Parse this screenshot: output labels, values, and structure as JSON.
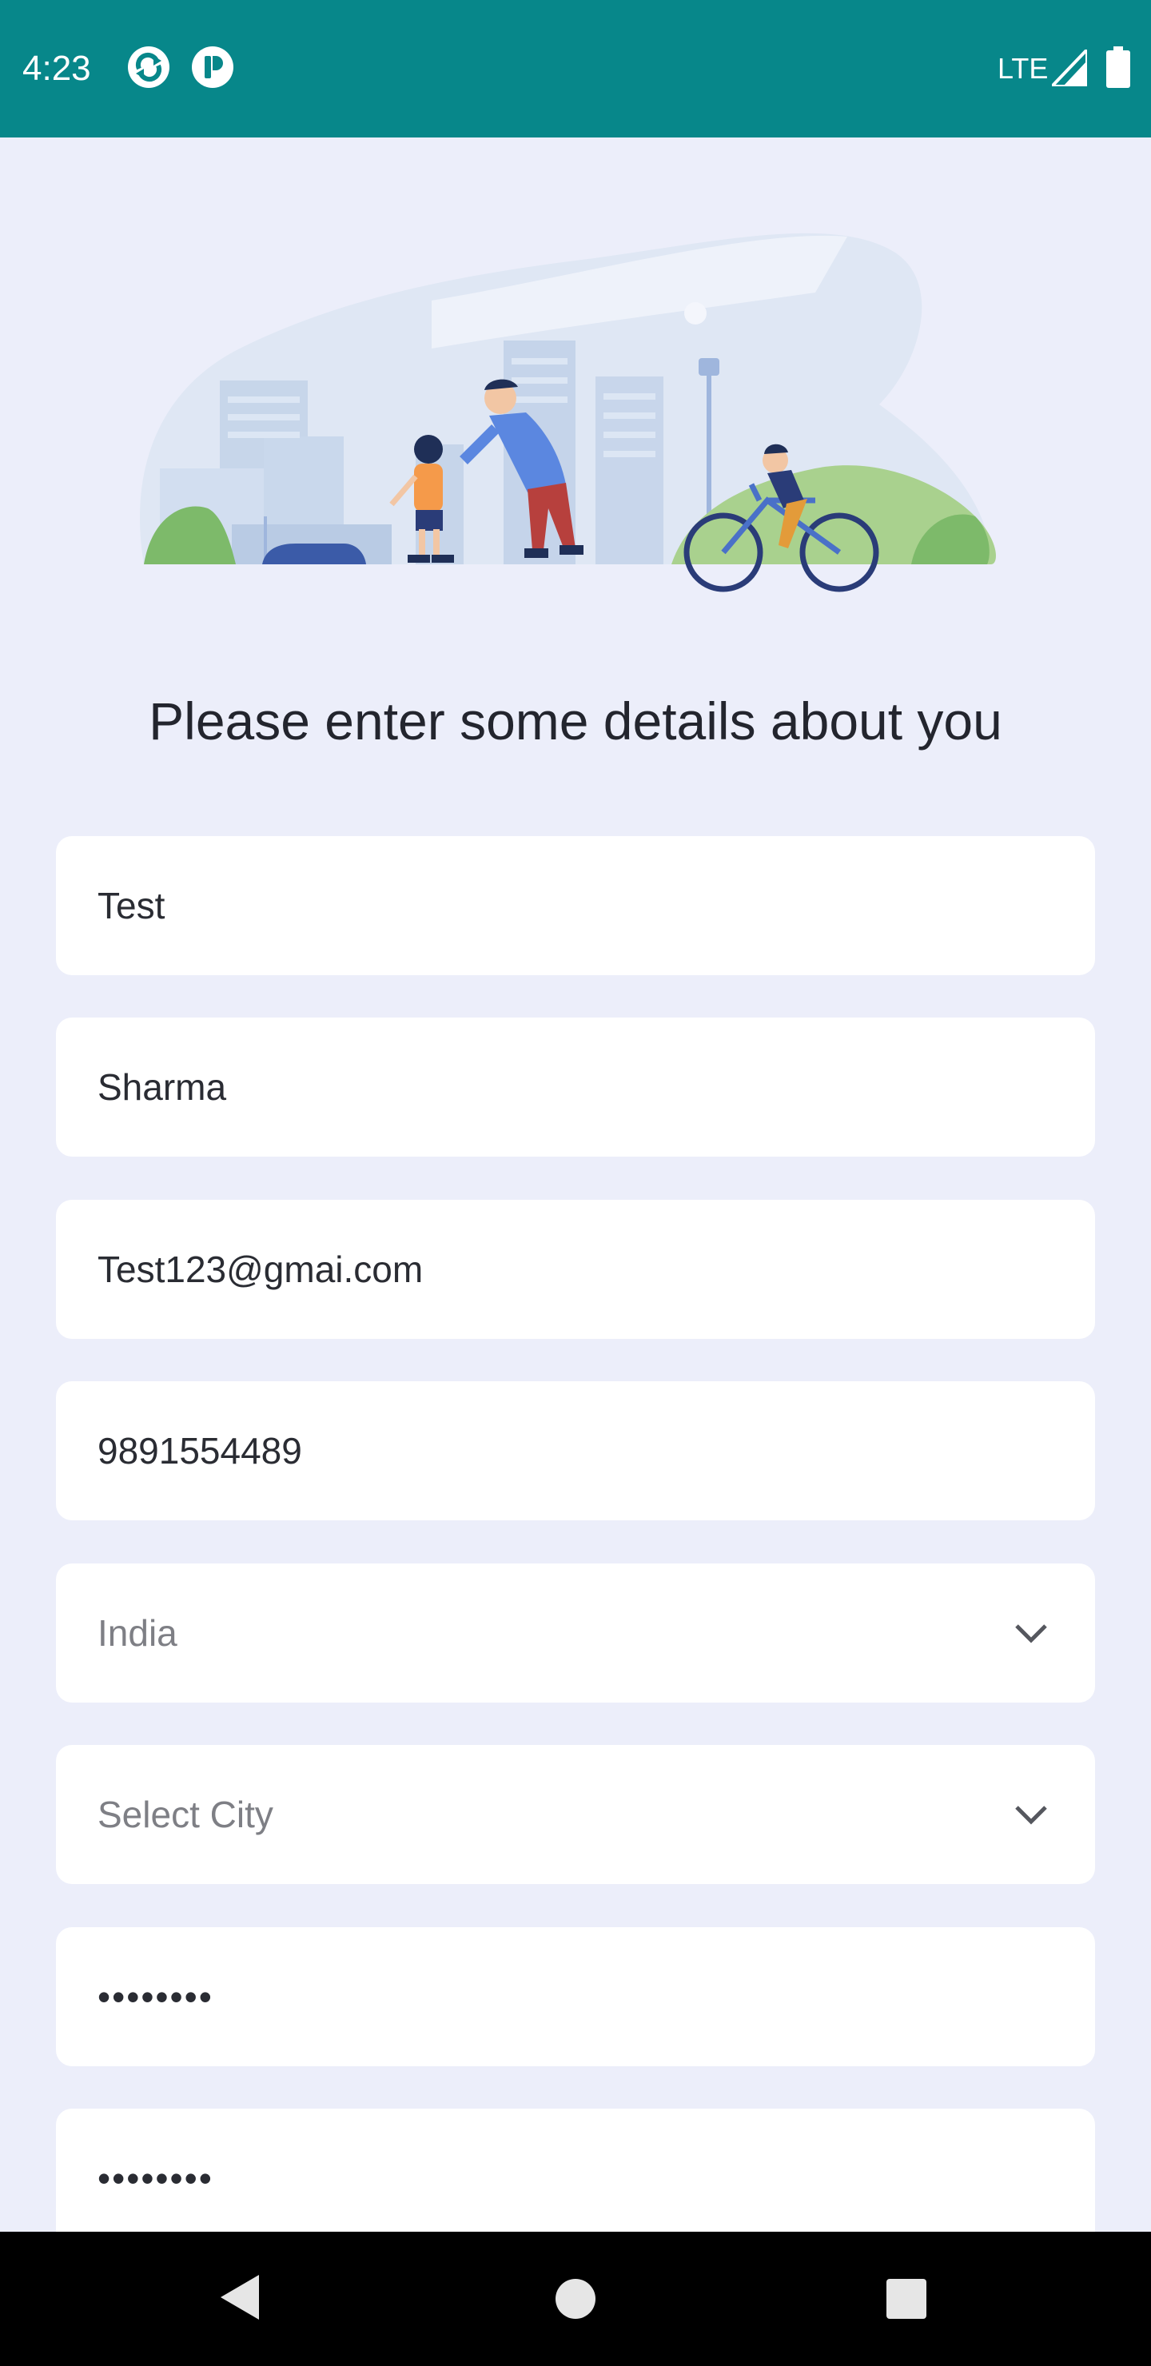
{
  "status_bar": {
    "time": "4:23",
    "network": "LTE",
    "icons": [
      "sync-app-icon",
      "pocket-app-icon",
      "signal-icon",
      "battery-icon"
    ]
  },
  "hero": {
    "icon": "city-park-illustration"
  },
  "heading": "Please enter some details about you",
  "form": {
    "first_name": "Test",
    "last_name": "Sharma",
    "email": "Test123@gmai.com",
    "phone": "9891554489",
    "country": "India",
    "city_placeholder": "Select City",
    "password": "••••••••",
    "confirm_password": "••••••••"
  },
  "nav_bar": {
    "icons": [
      "back-icon",
      "home-icon",
      "recents-icon"
    ]
  },
  "colors": {
    "status_bar": "#07878A",
    "background": "#ECEEFA",
    "field": "#FFFFFF",
    "text": "#23252E",
    "placeholder": "#7E7F85"
  }
}
